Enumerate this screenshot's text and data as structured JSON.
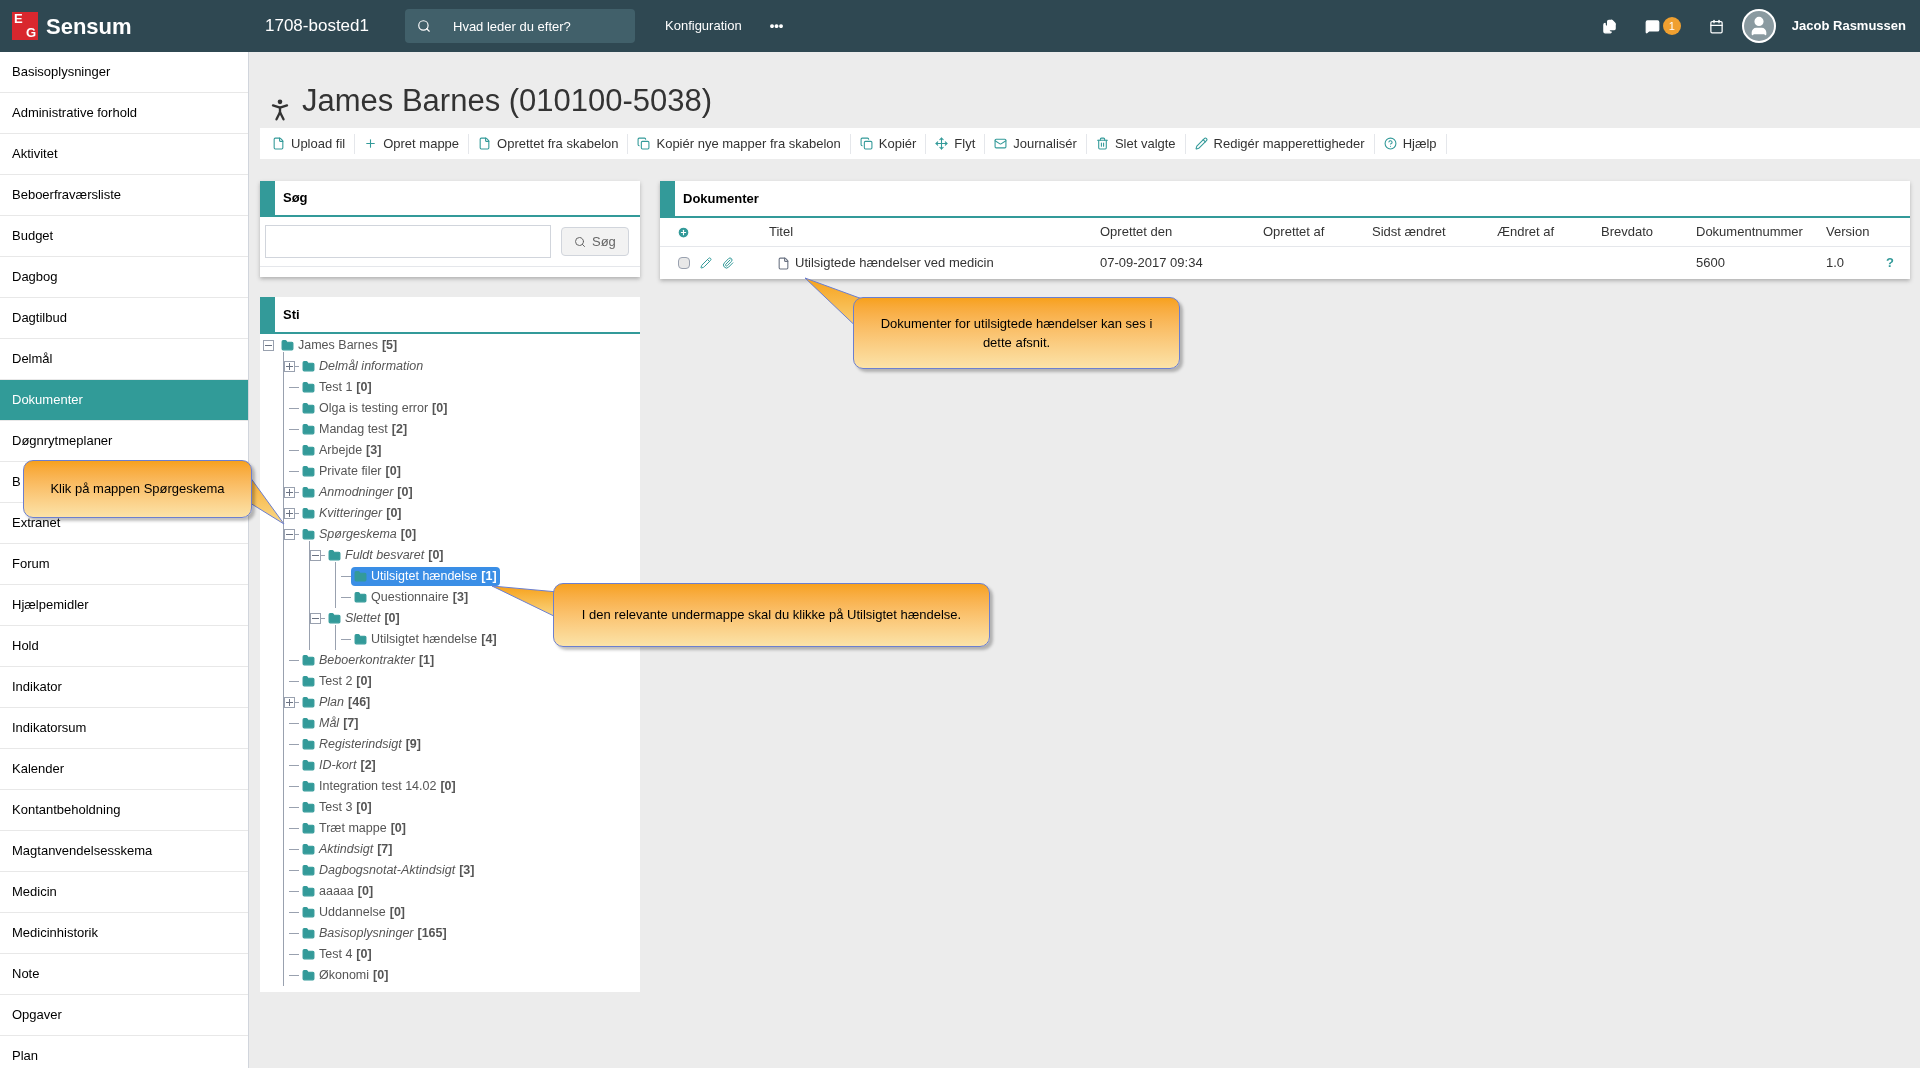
{
  "topbar": {
    "logo_letters": [
      "E",
      "G"
    ],
    "logo_text": "Sensum",
    "location": "1708-bosted1",
    "search": {
      "placeholder": "Hvad leder du efter?"
    },
    "menu": "Konfiguration",
    "more": "•••",
    "notification_count": "1",
    "user": "Jacob Rasmussen"
  },
  "sidebar": {
    "items": [
      {
        "label": "Basisoplysninger",
        "selected": false
      },
      {
        "label": "Administrative forhold",
        "selected": false
      },
      {
        "label": "Aktivitet",
        "selected": false
      },
      {
        "label": "Beboerfraværsliste",
        "selected": false
      },
      {
        "label": "Budget",
        "selected": false
      },
      {
        "label": "Dagbog",
        "selected": false
      },
      {
        "label": "Dagtilbud",
        "selected": false
      },
      {
        "label": "Delmål",
        "selected": false
      },
      {
        "label": "Dokumenter",
        "selected": true
      },
      {
        "label": "Døgnrytmeplaner",
        "selected": false
      },
      {
        "label": "B",
        "selected": false
      },
      {
        "label": "Extranet",
        "selected": false
      },
      {
        "label": "Forum",
        "selected": false
      },
      {
        "label": "Hjælpemidler",
        "selected": false
      },
      {
        "label": "Hold",
        "selected": false
      },
      {
        "label": "Indikator",
        "selected": false
      },
      {
        "label": "Indikatorsum",
        "selected": false
      },
      {
        "label": "Kalender",
        "selected": false
      },
      {
        "label": "Kontantbeholdning",
        "selected": false
      },
      {
        "label": "Magtanvendelsesskema",
        "selected": false
      },
      {
        "label": "Medicin",
        "selected": false
      },
      {
        "label": "Medicinhistorik",
        "selected": false
      },
      {
        "label": "Note",
        "selected": false
      },
      {
        "label": "Opgaver",
        "selected": false
      },
      {
        "label": "Plan",
        "selected": false
      }
    ]
  },
  "page": {
    "title": "James Barnes (010100-5038)"
  },
  "toolbar": [
    "Upload fil",
    "Opret mappe",
    "Oprettet fra skabelon",
    "Kopiér nye mapper fra skabelon",
    "Kopiér",
    "Flyt",
    "Journalisér",
    "Slet valgte",
    "Redigér mapperettigheder",
    "Hjælp"
  ],
  "search_panel": {
    "title": "Søg",
    "button": "Søg"
  },
  "tree_panel": {
    "title": "Sti",
    "root": {
      "label": "James Barnes",
      "count": "[5]",
      "kind": "folder",
      "selected": false,
      "expanded": true,
      "children": [
        {
          "label": "Delmål information",
          "kind": "template",
          "selected": false,
          "expanded": false
        },
        {
          "label": "Test 1",
          "count": "[0]",
          "kind": "folder",
          "selected": false
        },
        {
          "label": "Olga is testing error",
          "count": "[0]",
          "kind": "folder",
          "selected": false
        },
        {
          "label": "Mandag test",
          "count": "[2]",
          "kind": "folder",
          "selected": false
        },
        {
          "label": "Arbejde",
          "count": "[3]",
          "kind": "folder",
          "selected": false
        },
        {
          "label": "Private filer",
          "count": "[0]",
          "kind": "folder",
          "selected": false
        },
        {
          "label": "Anmodninger",
          "count": "[0]",
          "kind": "template",
          "selected": false,
          "expanded": false
        },
        {
          "label": "Kvitteringer",
          "count": "[0]",
          "kind": "template",
          "selected": false,
          "expanded": false
        },
        {
          "label": "Spørgeskema",
          "count": "[0]",
          "kind": "template",
          "selected": false,
          "expanded": true,
          "children": [
            {
              "label": "Fuldt besvaret",
              "count": "[0]",
              "kind": "template",
              "selected": false,
              "expanded": true,
              "children": [
                {
                  "label": "Utilsigtet hændelse",
                  "count": "[1]",
                  "kind": "folder",
                  "selected": true
                },
                {
                  "label": "Questionnaire",
                  "count": "[3]",
                  "kind": "folder",
                  "selected": false
                }
              ]
            },
            {
              "label": "Slettet",
              "count": "[0]",
              "kind": "template",
              "selected": false,
              "expanded": true,
              "children": [
                {
                  "label": "Utilsigtet hændelse",
                  "count": "[4]",
                  "kind": "folder",
                  "selected": false
                }
              ]
            }
          ]
        },
        {
          "label": "Beboerkontrakter",
          "count": "[1]",
          "kind": "template",
          "selected": false
        },
        {
          "label": "Test 2",
          "count": "[0]",
          "kind": "folder",
          "selected": false
        },
        {
          "label": "Plan",
          "count": "[46]",
          "kind": "template",
          "selected": false,
          "expanded": false
        },
        {
          "label": "Mål",
          "count": "[7]",
          "kind": "template",
          "selected": false
        },
        {
          "label": "Registerindsigt",
          "count": "[9]",
          "kind": "template",
          "selected": false
        },
        {
          "label": "ID-kort",
          "count": "[2]",
          "kind": "template",
          "selected": false
        },
        {
          "label": "Integration test 14.02",
          "count": "[0]",
          "kind": "folder",
          "selected": false
        },
        {
          "label": "Test 3",
          "count": "[0]",
          "kind": "folder",
          "selected": false
        },
        {
          "label": "Træt mappe",
          "count": "[0]",
          "kind": "folder",
          "selected": false
        },
        {
          "label": "Aktindsigt",
          "count": "[7]",
          "kind": "template",
          "selected": false
        },
        {
          "label": "Dagbogsnotat-Aktindsigt",
          "count": "[3]",
          "kind": "template",
          "selected": false
        },
        {
          "label": "aaaaa",
          "count": "[0]",
          "kind": "folder",
          "selected": false
        },
        {
          "label": "Uddannelse",
          "count": "[0]",
          "kind": "folder",
          "selected": false
        },
        {
          "label": "Basisoplysninger",
          "count": "[165]",
          "kind": "template",
          "selected": false
        },
        {
          "label": "Test 4",
          "count": "[0]",
          "kind": "folder",
          "selected": false
        },
        {
          "label": "Økonomi",
          "count": "[0]",
          "kind": "folder",
          "selected": false
        }
      ]
    }
  },
  "documents_panel": {
    "title": "Dokumenter",
    "columns": [
      "Titel",
      "Oprettet den",
      "Oprettet af",
      "Sidst ændret",
      "Ændret af",
      "Brevdato",
      "Dokumentnummer",
      "Version"
    ],
    "rows": [
      {
        "checked": false,
        "cells": [
          "Utilsigtede hændelser ved medicin",
          "07-09-2017 09:34",
          "",
          "",
          "",
          "",
          "5600",
          "1.0"
        ],
        "help": "?"
      }
    ]
  },
  "callouts": [
    "Dokumenter for utilsigtede hændelser kan ses i dette afsnit.",
    "Klik på mappen Spørgeskema",
    "I den relevante undermappe skal du klikke på Utilsigtet hændelse."
  ]
}
